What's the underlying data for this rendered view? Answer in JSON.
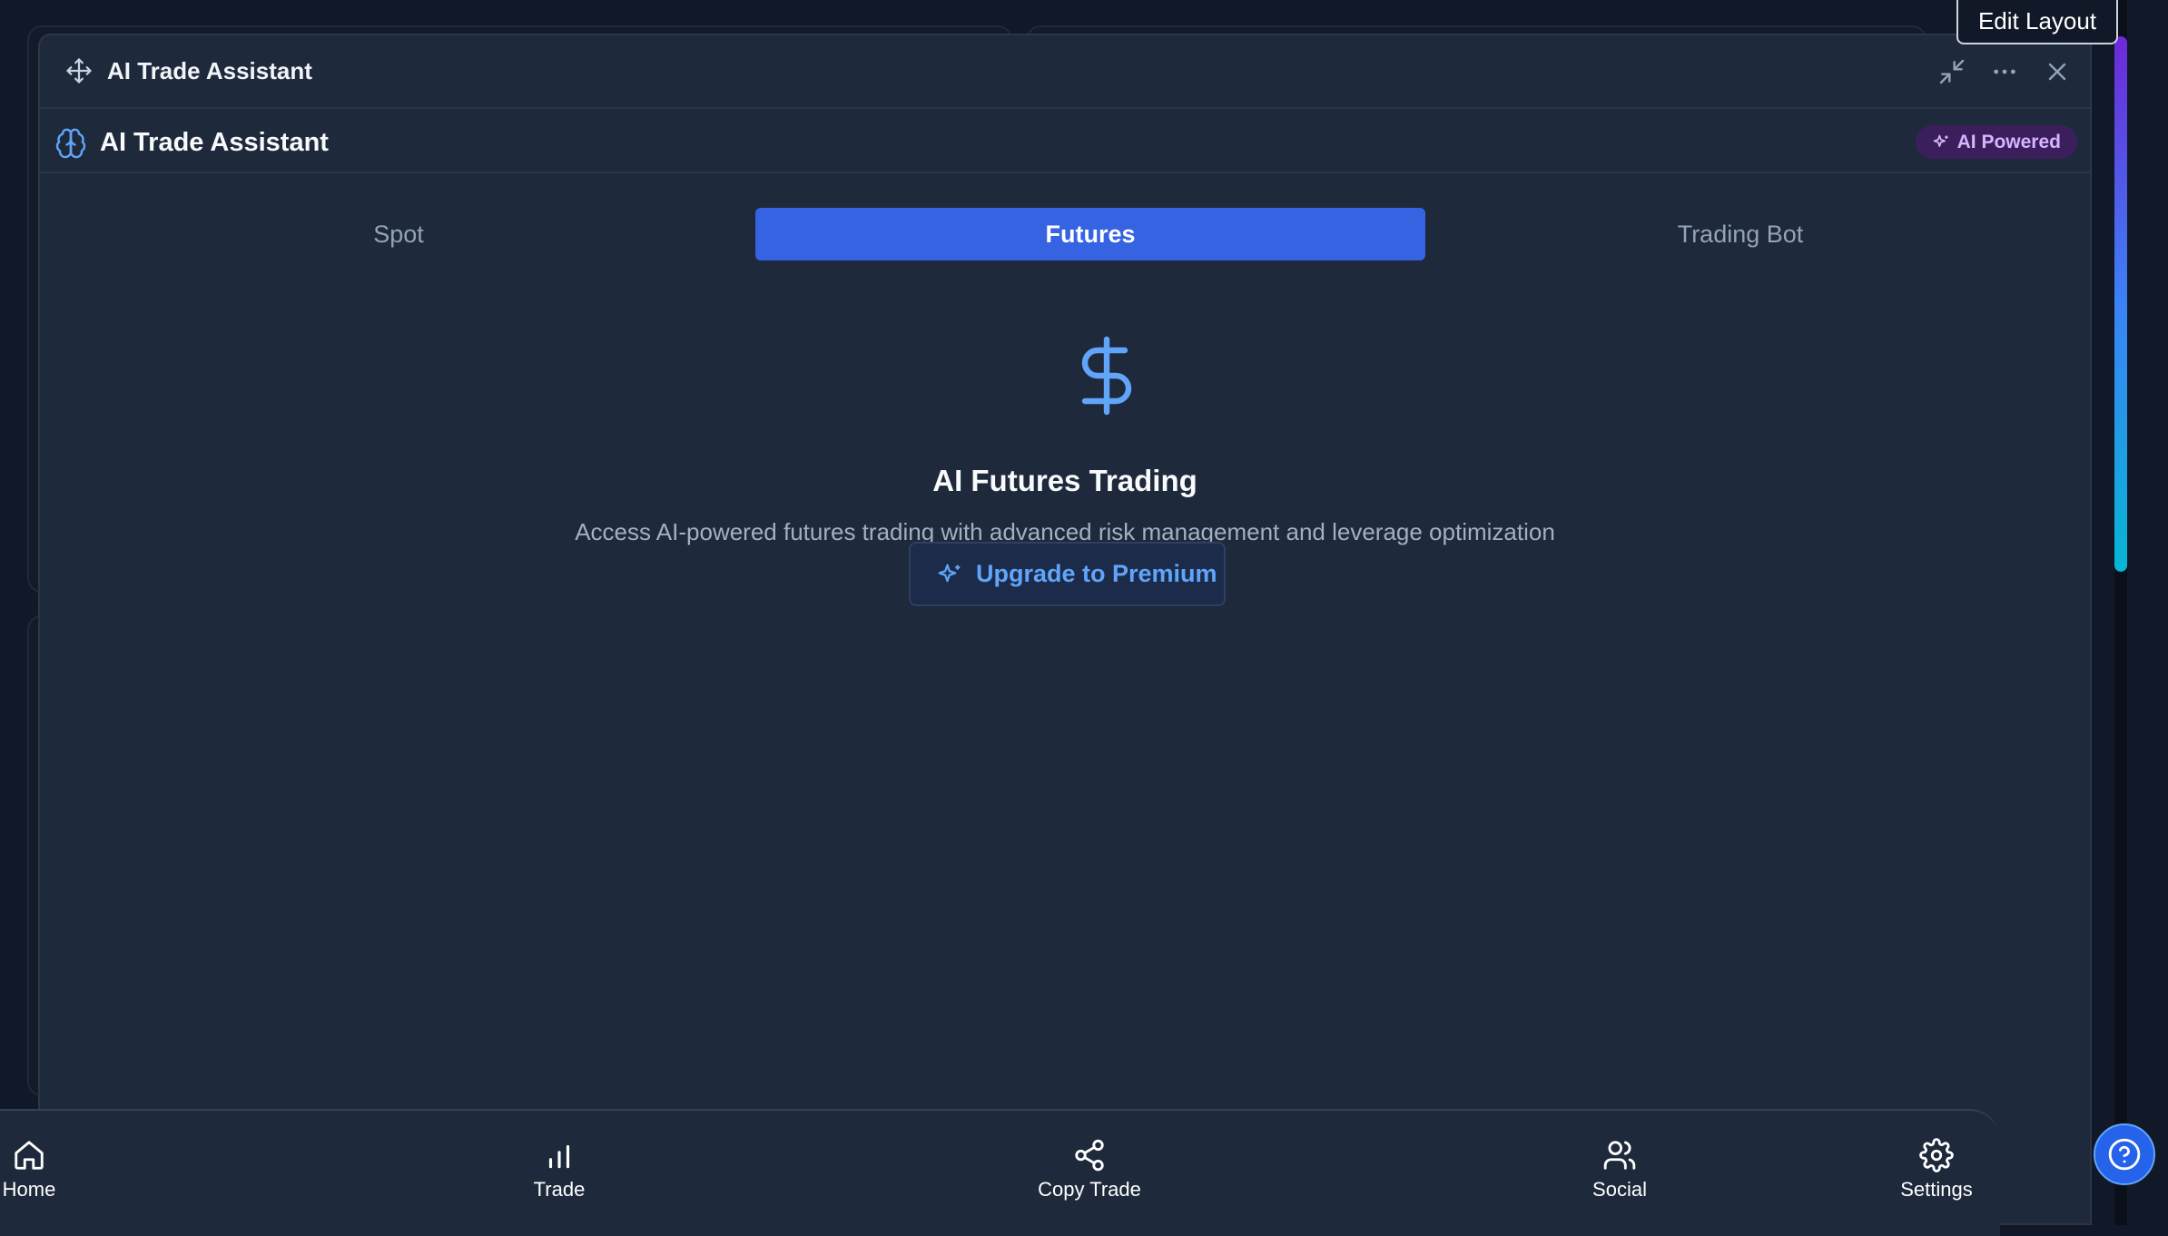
{
  "window": {
    "title": "AI Trade Assistant"
  },
  "header": {
    "title": "AI Trade Assistant",
    "badge": "AI Powered"
  },
  "tabs": [
    {
      "label": "Spot",
      "active": false
    },
    {
      "label": "Futures",
      "active": true
    },
    {
      "label": "Trading Bot",
      "active": false
    }
  ],
  "content": {
    "icon": "dollar-icon",
    "heading": "AI Futures Trading",
    "description": "Access AI-powered futures trading with advanced risk management and leverage optimization",
    "upgrade_label": "Upgrade to Premium"
  },
  "toolbar": {
    "edit_layout_label": "Edit Layout"
  },
  "bottom_nav": {
    "items": [
      {
        "label": "Home",
        "icon": "home-icon"
      },
      {
        "label": "Trade",
        "icon": "bar-chart-icon"
      },
      {
        "label": "Copy Trade",
        "icon": "share-icon"
      },
      {
        "label": "Social",
        "icon": "users-icon"
      },
      {
        "label": "Settings",
        "icon": "gear-icon"
      }
    ]
  },
  "colors": {
    "accent": "#3563e2",
    "badge_bg": "#3b1f5c",
    "badge_text": "#d8b4fe",
    "link": "#60a5fa"
  }
}
